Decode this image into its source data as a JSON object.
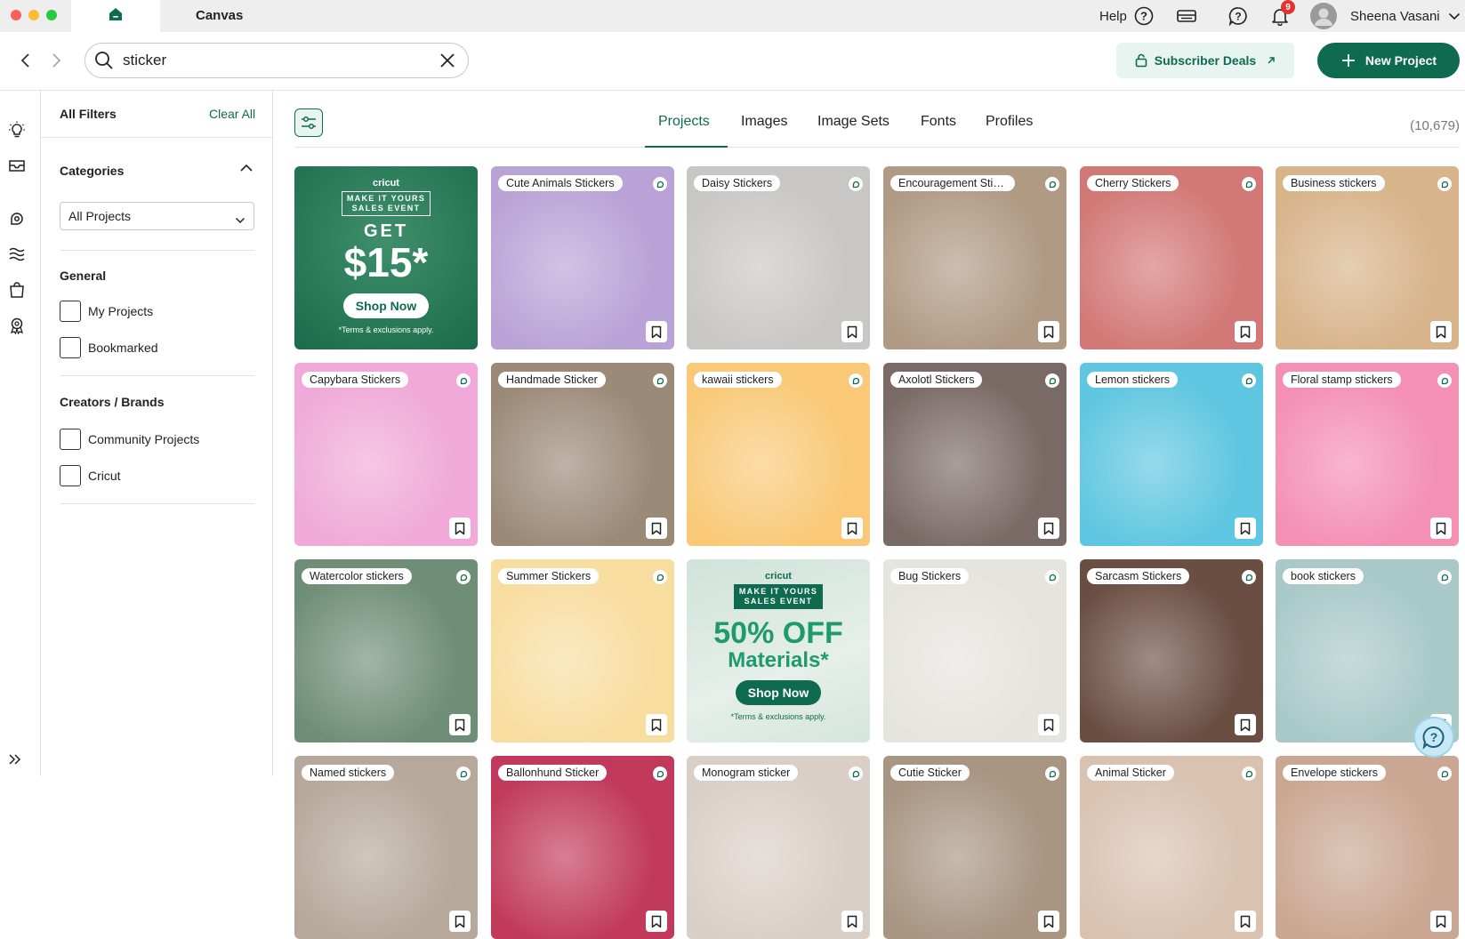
{
  "window": {
    "app_title": "Canvas",
    "traffic_lights": [
      "#ff5f57",
      "#febc2e",
      "#28c840"
    ]
  },
  "titlebar": {
    "help_label": "Help",
    "notification_count": "9",
    "user_name": "Sheena Vasani"
  },
  "search": {
    "query": "sticker",
    "placeholder": "Search"
  },
  "actions": {
    "subscriber_deals": "Subscriber Deals",
    "new_project": "New Project"
  },
  "colors": {
    "brand_green": "#0f6b4f",
    "light_green": "#e8f4ef",
    "badge_red": "#e3342f"
  },
  "filters": {
    "title": "All Filters",
    "clear_all": "Clear All",
    "categories": {
      "heading": "Categories",
      "selected": "All Projects"
    },
    "general": {
      "heading": "General",
      "options": [
        "My Projects",
        "Bookmarked"
      ]
    },
    "creators": {
      "heading": "Creators / Brands",
      "options": [
        "Community Projects",
        "Cricut"
      ]
    }
  },
  "tabs": [
    "Projects",
    "Images",
    "Image Sets",
    "Fonts",
    "Profiles"
  ],
  "active_tab": "Projects",
  "result_count": "(10,679)",
  "ads": {
    "brand": "cricut",
    "event_line1": "MAKE IT YOURS",
    "event_line2": "SALES EVENT",
    "get_label": "GET",
    "amount": "$15*",
    "percent_off": "50% OFF",
    "materials": "Materials*",
    "shop_now": "Shop Now",
    "terms": "*Terms & exclusions apply."
  },
  "cards": [
    {
      "label": "Cute Animals Stickers",
      "bg": "#b9a3d6"
    },
    {
      "label": "Daisy Stickers",
      "bg": "#c9c7c4"
    },
    {
      "label": "Encouragement Stick...",
      "bg": "#b09a84"
    },
    {
      "label": "Cherry Stickers",
      "bg": "#d27876"
    },
    {
      "label": "Business stickers",
      "bg": "#d7b48a"
    },
    {
      "label": "Capybara Stickers",
      "bg": "#f0a9d8"
    },
    {
      "label": "Handmade Sticker",
      "bg": "#9b8a78"
    },
    {
      "label": "kawaii stickers",
      "bg": "#f9c978"
    },
    {
      "label": "Axolotl Stickers",
      "bg": "#7a6a66"
    },
    {
      "label": "Lemon stickers",
      "bg": "#5ec6e0"
    },
    {
      "label": "Floral stamp stickers",
      "bg": "#f48fb6"
    },
    {
      "label": "Watercolor stickers",
      "bg": "#6f8e78"
    },
    {
      "label": "Summer Stickers",
      "bg": "#f8dda0"
    },
    {
      "label": "Bug Stickers",
      "bg": "#e5e4de"
    },
    {
      "label": "Sarcasm Stickers",
      "bg": "#6b4e42"
    },
    {
      "label": "book stickers",
      "bg": "#a8c9c8"
    },
    {
      "label": "Named stickers",
      "bg": "#b6a89a"
    },
    {
      "label": "Ballonhund Sticker",
      "bg": "#c13a5b"
    },
    {
      "label": "Monogram sticker",
      "bg": "#d9cfc6"
    },
    {
      "label": "Cutie Sticker",
      "bg": "#a89582"
    },
    {
      "label": "Animal Sticker",
      "bg": "#d9c2b0"
    },
    {
      "label": "Envelope stickers",
      "bg": "#caa792"
    }
  ]
}
